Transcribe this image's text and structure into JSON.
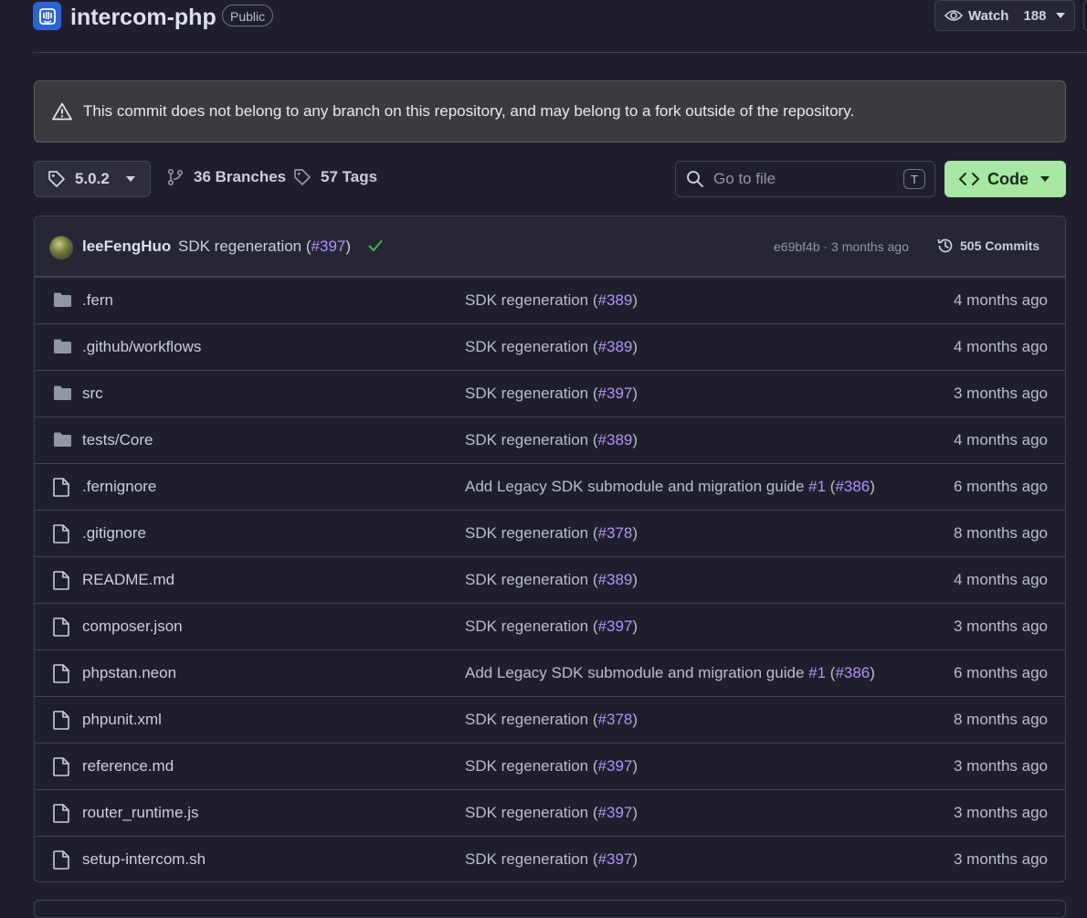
{
  "header": {
    "repo_name": "intercom-php",
    "visibility": "Public",
    "watch_label": "Watch",
    "watch_count": "188"
  },
  "warning": {
    "text": "This commit does not belong to any branch on this repository, and may belong to a fork outside of the repository."
  },
  "toolbar": {
    "branch": "5.0.2",
    "branches_label": "36 Branches",
    "tags_label": "57 Tags",
    "search_placeholder": "Go to file",
    "search_shortcut": "T",
    "code_label": "Code"
  },
  "commit": {
    "author": "leeFengHuo",
    "message_prefix": "SDK regeneration (",
    "message_link": "#397",
    "message_suffix": ")",
    "meta": "e69bf4b · 3 months ago",
    "commits_label": "505 Commits"
  },
  "files": [
    {
      "name": ".fern",
      "type": "folder",
      "msg_prefix": "SDK regeneration (",
      "msg_link": "#389",
      "msg_link2": "",
      "msg_mid": "",
      "msg_suffix": ")",
      "time": "4 months ago"
    },
    {
      "name": ".github/workflows",
      "type": "folder",
      "msg_prefix": "SDK regeneration (",
      "msg_link": "#389",
      "msg_link2": "",
      "msg_mid": "",
      "msg_suffix": ")",
      "time": "4 months ago"
    },
    {
      "name": "src",
      "type": "folder",
      "msg_prefix": "SDK regeneration (",
      "msg_link": "#397",
      "msg_link2": "",
      "msg_mid": "",
      "msg_suffix": ")",
      "time": "3 months ago"
    },
    {
      "name": "tests/Core",
      "type": "folder",
      "msg_prefix": "SDK regeneration (",
      "msg_link": "#389",
      "msg_link2": "",
      "msg_mid": "",
      "msg_suffix": ")",
      "time": "4 months ago"
    },
    {
      "name": ".fernignore",
      "type": "file",
      "msg_prefix": "Add Legacy SDK submodule and migration guide ",
      "msg_link": "#1",
      "msg_mid": " (",
      "msg_link2": "#386",
      "msg_suffix": ")",
      "time": "6 months ago"
    },
    {
      "name": ".gitignore",
      "type": "file",
      "msg_prefix": "SDK regeneration (",
      "msg_link": "#378",
      "msg_link2": "",
      "msg_mid": "",
      "msg_suffix": ")",
      "time": "8 months ago"
    },
    {
      "name": "README.md",
      "type": "file",
      "msg_prefix": "SDK regeneration (",
      "msg_link": "#389",
      "msg_link2": "",
      "msg_mid": "",
      "msg_suffix": ")",
      "time": "4 months ago"
    },
    {
      "name": "composer.json",
      "type": "file",
      "msg_prefix": "SDK regeneration (",
      "msg_link": "#397",
      "msg_link2": "",
      "msg_mid": "",
      "msg_suffix": ")",
      "time": "3 months ago"
    },
    {
      "name": "phpstan.neon",
      "type": "file",
      "msg_prefix": "Add Legacy SDK submodule and migration guide ",
      "msg_link": "#1",
      "msg_mid": " (",
      "msg_link2": "#386",
      "msg_suffix": ")",
      "time": "6 months ago"
    },
    {
      "name": "phpunit.xml",
      "type": "file",
      "msg_prefix": "SDK regeneration (",
      "msg_link": "#378",
      "msg_link2": "",
      "msg_mid": "",
      "msg_suffix": ")",
      "time": "8 months ago"
    },
    {
      "name": "reference.md",
      "type": "file",
      "msg_prefix": "SDK regeneration (",
      "msg_link": "#397",
      "msg_link2": "",
      "msg_mid": "",
      "msg_suffix": ")",
      "time": "3 months ago"
    },
    {
      "name": "router_runtime.js",
      "type": "file",
      "msg_prefix": "SDK regeneration (",
      "msg_link": "#397",
      "msg_link2": "",
      "msg_mid": "",
      "msg_suffix": ")",
      "time": "3 months ago"
    },
    {
      "name": "setup-intercom.sh",
      "type": "file",
      "msg_prefix": "SDK regeneration (",
      "msg_link": "#397",
      "msg_link2": "",
      "msg_mid": "",
      "msg_suffix": ")",
      "time": "3 months ago"
    }
  ],
  "colors": {
    "background": "#1f1e2c",
    "accent_link": "#b891ff",
    "code_button": "#a8e6a3",
    "check": "#3fb950"
  }
}
